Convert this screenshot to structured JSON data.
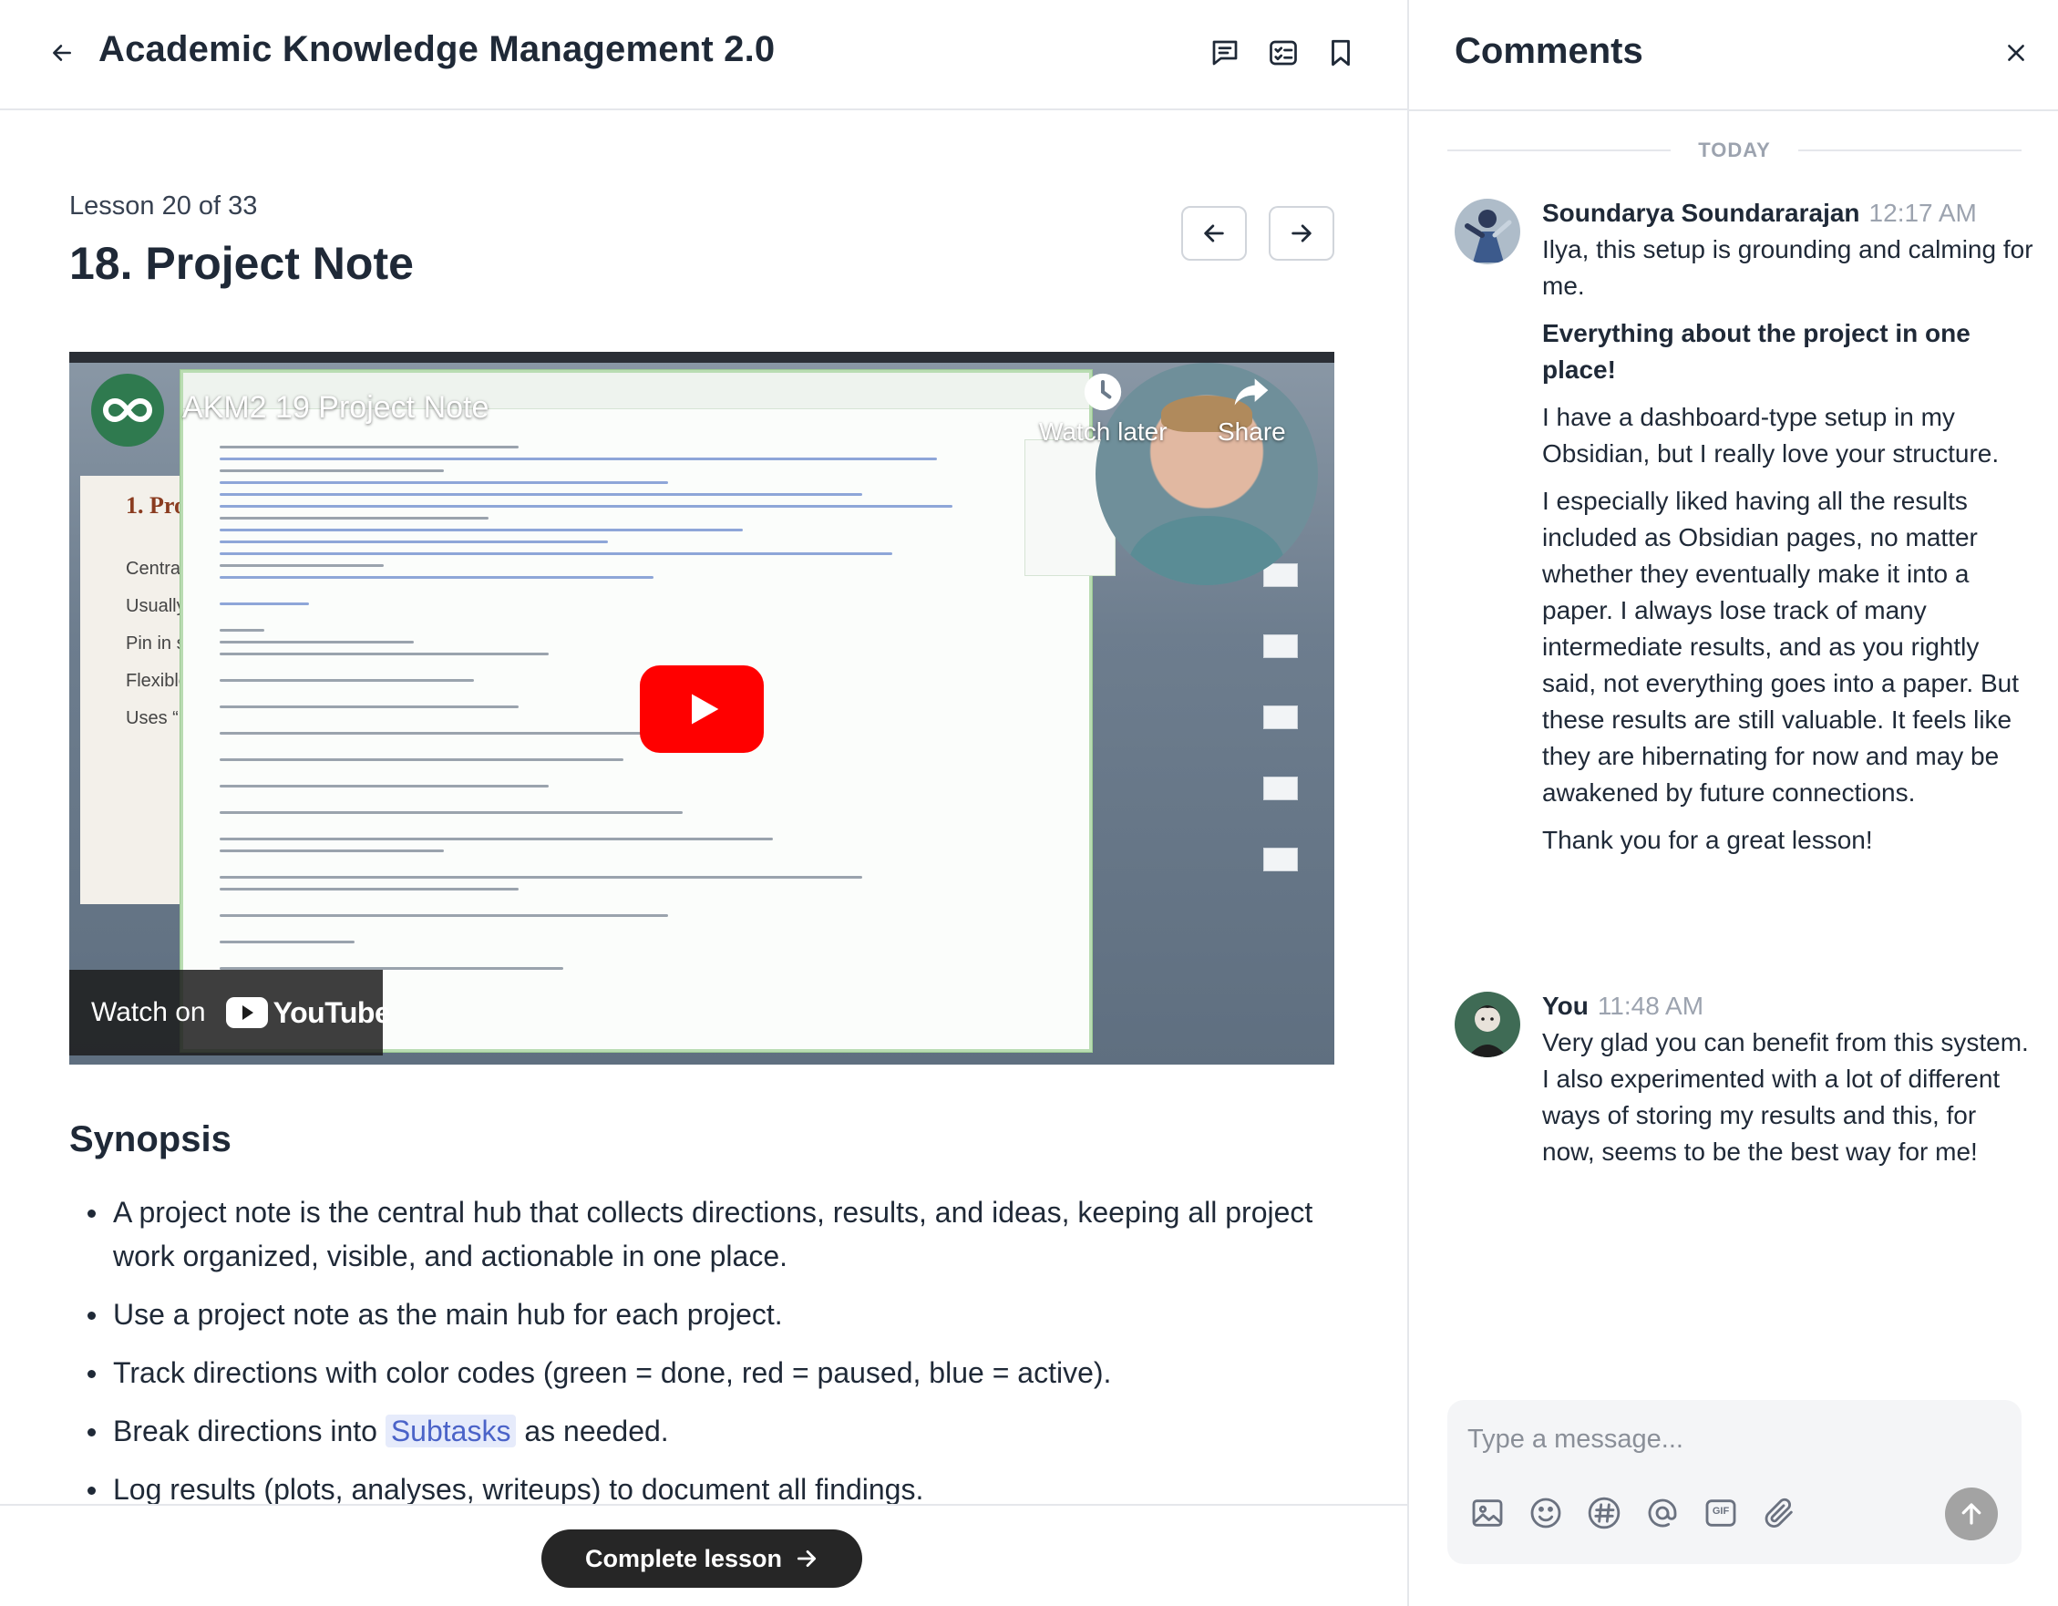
{
  "header": {
    "title": "Academic Knowledge Management 2.0",
    "icons": [
      "back-arrow-icon",
      "comments-icon",
      "checklist-icon",
      "bookmark-icon"
    ]
  },
  "lesson": {
    "counter": "Lesson 20 of 33",
    "title": "18. Project Note"
  },
  "video": {
    "title": "AKM2 19 Project Note",
    "watch_later": "Watch later",
    "share": "Share",
    "watch_on": "Watch on",
    "youtube": "YouTube",
    "slide_title": "1. Pro",
    "slide_lines": [
      "Centra",
      "Usually",
      "Pin in s",
      "Flexible",
      "Uses “"
    ]
  },
  "synopsis": {
    "title": "Synopsis",
    "items": [
      "A project note is the central hub that collects directions, results, and ideas, keeping all project work organized, visible, and actionable in one place.",
      "Use a project note as the main hub for each project.",
      "Track directions with color codes (green = done, red = paused, blue = active).",
      "Log results (plots, analyses, writeups) to document all findings."
    ],
    "item4_before": "Break directions into",
    "item4_link": "Subtasks",
    "item4_after": "as needed."
  },
  "footer": {
    "complete_label": "Complete lesson"
  },
  "comments": {
    "title": "Comments",
    "day_label": "TODAY",
    "list": [
      {
        "author": "Soundarya Soundararajan",
        "time": "12:17 AM",
        "paragraphs": [
          "Ilya, this setup is grounding and calming for me.",
          "Everything about the project in one place!",
          "I have a dashboard-type setup in my Obsidian, but I really love your structure.",
          "I especially liked having all the re­sults included as Obsidian pages, no matter whether they eventually make it into a paper. I always lose track of many intermediate results, and as you rightly said, not everything goes into a paper. But these results are still valuable. It feels like they are hiber­nating for now and may be awakened by future connections.",
          "Thank you for a great lesson!"
        ]
      },
      {
        "author": "You",
        "time": "11:48 AM",
        "paragraphs": [
          "Very glad you can benefit from this system. I also experimented with a lot of different ways of storing my re­sults and this, for now, seems to be the best way for me!"
        ]
      }
    ],
    "composer_placeholder": "Type a message...",
    "tools": [
      "image-icon",
      "emoji-icon",
      "hashtag-icon",
      "mention-icon",
      "gif-icon",
      "attachment-icon"
    ],
    "gif_label": "GIF"
  },
  "colors": {
    "accent_link": "#4b63c8",
    "link_bg": "#e6ebfb",
    "dark_button": "#262626",
    "play_red": "#ff0000",
    "send_grey": "#a3a3a3"
  }
}
